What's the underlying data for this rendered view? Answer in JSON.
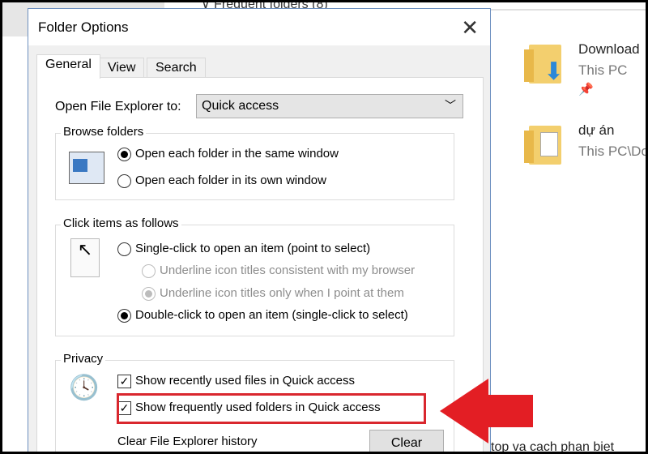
{
  "background": {
    "top_text": "∨ Frequent folders (8)",
    "bottom_text": "top va cach phan biet",
    "items": [
      {
        "name": "Download",
        "sub": "This PC",
        "pinned": true
      },
      {
        "name": "dự án",
        "sub": "This PC\\Do"
      }
    ]
  },
  "dialog": {
    "title": "Folder Options",
    "close_label": "✕",
    "tabs": [
      {
        "label": "General",
        "active": true
      },
      {
        "label": "View"
      },
      {
        "label": "Search"
      }
    ],
    "open_explorer": {
      "label": "Open File Explorer to:",
      "value": "Quick access"
    },
    "browse": {
      "label": "Browse folders",
      "options": [
        {
          "label": "Open each folder in the same window",
          "selected": true
        },
        {
          "label": "Open each folder in its own window",
          "selected": false
        }
      ]
    },
    "click": {
      "label": "Click items as follows",
      "options": [
        {
          "label": "Single-click to open an item (point to select)",
          "selected": false
        },
        {
          "label": "Underline icon titles consistent with my browser",
          "selected": false,
          "disabled": true
        },
        {
          "label": "Underline icon titles only when I point at them",
          "selected": true,
          "disabled": true
        },
        {
          "label": "Double-click to open an item (single-click to select)",
          "selected": true
        }
      ]
    },
    "privacy": {
      "label": "Privacy",
      "checks": [
        {
          "label": "Show recently used files in Quick access",
          "checked": true
        },
        {
          "label": "Show frequently used folders in Quick access",
          "checked": true
        }
      ],
      "clear_label": "Clear File Explorer history",
      "clear_button": "Clear"
    }
  },
  "colors": {
    "highlight": "#d9272e",
    "arrow": "#e31e24",
    "accent": "#6c8fbf"
  }
}
